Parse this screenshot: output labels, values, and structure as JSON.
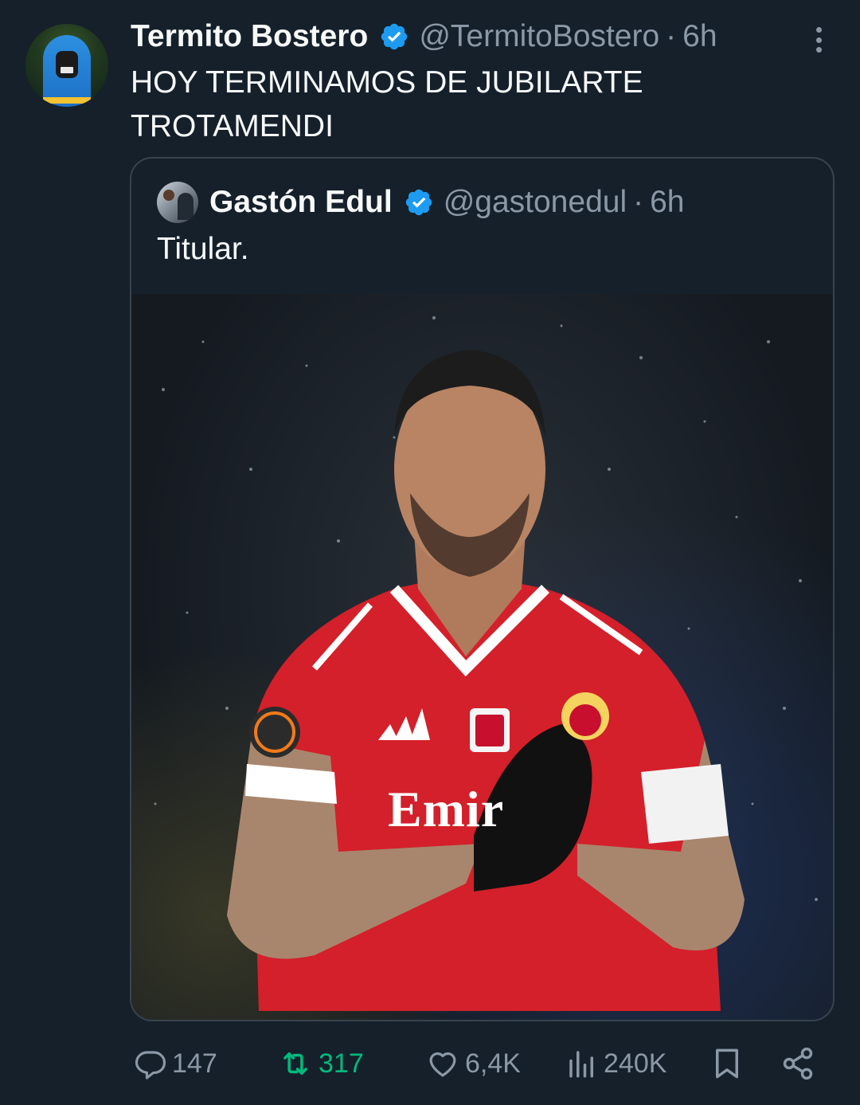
{
  "tweet": {
    "author_name": "Termito Bostero",
    "author_handle": "@TermitoBostero",
    "separator": "·",
    "time": "6h",
    "text_line1": "HOY TERMINAMOS DE JUBILARTE",
    "text_line2": "TROTAMENDI"
  },
  "quote": {
    "author_name": "Gastón Edul",
    "author_handle": "@gastonedul",
    "separator": "·",
    "time": "6h",
    "text": "Titular.",
    "jersey_sponsor": "Emir"
  },
  "actions": {
    "replies": "147",
    "retweets": "317",
    "likes": "6,4K",
    "views": "240K"
  },
  "colors": {
    "background": "#15202b",
    "secondary_text": "#8b98a5",
    "verified": "#1d9bf0",
    "retweet_active": "#00ba7c",
    "border": "#38444d"
  },
  "icons": [
    "more-icon",
    "verified-icon",
    "reply-icon",
    "retweet-icon",
    "like-icon",
    "views-icon",
    "bookmark-icon",
    "share-icon"
  ]
}
